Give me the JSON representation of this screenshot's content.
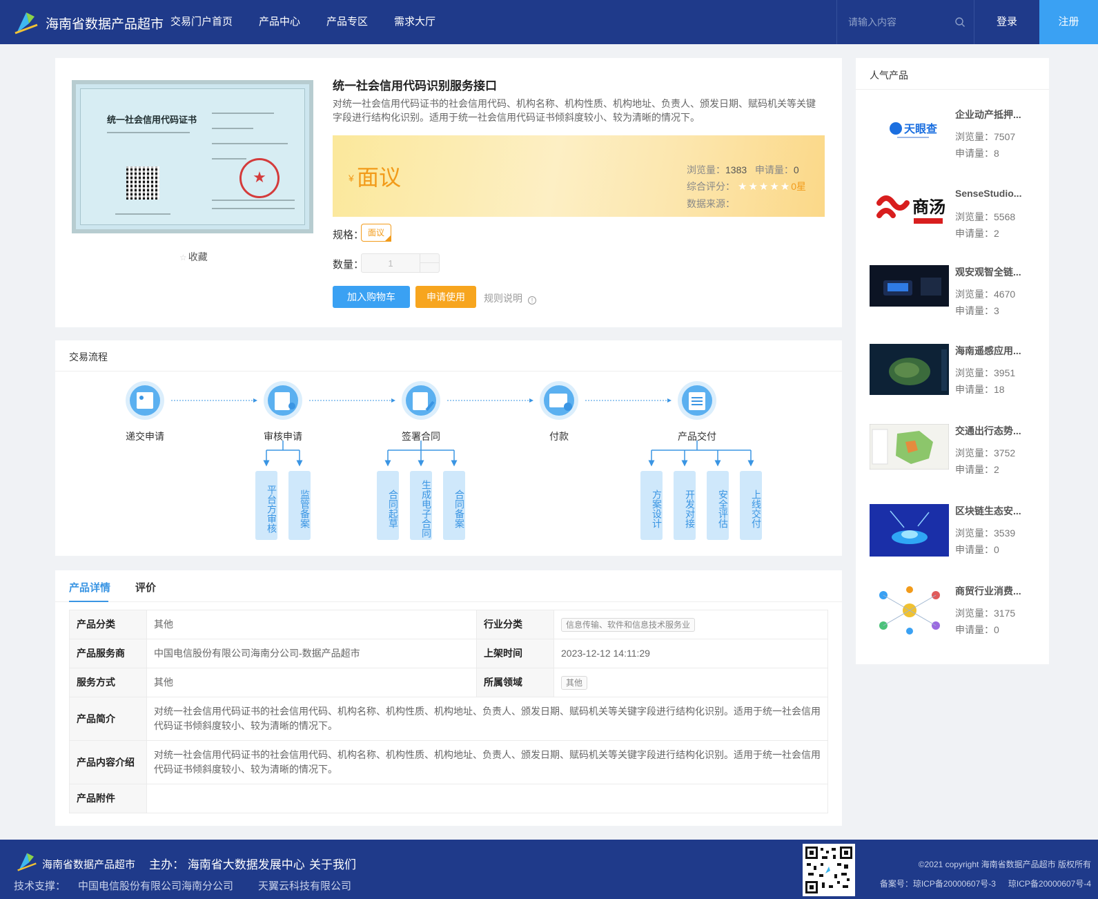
{
  "header": {
    "site_title": "海南省数据产品超市",
    "nav": [
      "交易门户首页",
      "产品中心",
      "产品专区",
      "需求大厅"
    ],
    "search_placeholder": "请输入内容",
    "login": "登录",
    "register": "注册",
    "brand_color": "#1f3a8a"
  },
  "product": {
    "title": "统一社会信用代码识别服务接口",
    "description": "对统一社会信用代码证书的社会信用代码、机构名称、机构性质、机构地址、负责人、颁发日期、赋码机关等关键字段进行结构化识别。适用于统一社会信用代码证书倾斜度较小、较为清晰的情况下。",
    "image_caption": "统一社会信用代码证书",
    "favorite": "收藏",
    "price_symbol": "¥",
    "price": "面议",
    "views_label": "浏览量：",
    "views": "1383",
    "applies_label": "申请量：",
    "applies": "0",
    "rating_label": "综合评分：",
    "rating_stars": 0,
    "rating_text": "0星",
    "source_label": "数据来源：",
    "spec_label": "规格：",
    "spec_value": "面议",
    "qty_label": "数量：",
    "qty_value": "1",
    "add_cart": "加入购物车",
    "apply": "申请使用",
    "rules": "规则说明"
  },
  "flow": {
    "title": "交易流程",
    "steps": [
      {
        "label": "递交申请",
        "subs": []
      },
      {
        "label": "审核申请",
        "subs": [
          "平台方审核",
          "监管备案"
        ]
      },
      {
        "label": "签署合同",
        "subs": [
          "合同起草",
          "生成电子合同",
          "合同备案"
        ]
      },
      {
        "label": "付款",
        "subs": []
      },
      {
        "label": "产品交付",
        "subs": [
          "方案设计",
          "开发对接",
          "安全评估",
          "上线交付"
        ]
      }
    ]
  },
  "details": {
    "tabs": [
      "产品详情",
      "评价"
    ],
    "rows": {
      "category_k": "产品分类",
      "category_v": "其他",
      "industry_k": "行业分类",
      "industry_v": "信息传输、软件和信息技术服务业",
      "provider_k": "产品服务商",
      "provider_v": "中国电信股份有限公司海南分公司-数据产品超市",
      "listed_k": "上架时间",
      "listed_v": "2023-12-12 14:11:29",
      "service_k": "服务方式",
      "service_v": "其他",
      "domain_k": "所属领域",
      "domain_v": "其他",
      "intro_k": "产品简介",
      "intro_v": "对统一社会信用代码证书的社会信用代码、机构名称、机构性质、机构地址、负责人、颁发日期、赋码机关等关键字段进行结构化识别。适用于统一社会信用代码证书倾斜度较小、较为清晰的情况下。",
      "content_k": "产品内容介绍",
      "content_v": "对统一社会信用代码证书的社会信用代码、机构名称、机构性质、机构地址、负责人、颁发日期、赋码机关等关键字段进行结构化识别。适用于统一社会信用代码证书倾斜度较小、较为清晰的情况下。",
      "attach_k": "产品附件",
      "attach_v": ""
    }
  },
  "sidebar": {
    "title": "人气产品",
    "views_label": "浏览量：",
    "applies_label": "申请量：",
    "items": [
      {
        "name": "企业动产抵押...",
        "views": "7507",
        "applies": "8",
        "thumb": "tianyancha-logo",
        "thumb_text": "天眼查"
      },
      {
        "name": "SenseStudio...",
        "views": "5568",
        "applies": "2",
        "thumb": "sensetime-logo",
        "thumb_text": "商汤"
      },
      {
        "name": "观安观智全链...",
        "views": "4670",
        "applies": "3",
        "thumb": "dashboard-screenshot"
      },
      {
        "name": "海南遥感应用...",
        "views": "3951",
        "applies": "18",
        "thumb": "satellite-map"
      },
      {
        "name": "交通出行态势...",
        "views": "3752",
        "applies": "2",
        "thumb": "traffic-map"
      },
      {
        "name": "区块链生态安...",
        "views": "3539",
        "applies": "0",
        "thumb": "blockchain-graphic"
      },
      {
        "name": "商贸行业消费...",
        "views": "3175",
        "applies": "0",
        "thumb": "network-icons"
      }
    ]
  },
  "footer": {
    "title": "海南省数据产品超市",
    "host_label": "主办：",
    "host": "海南省大数据发展中心",
    "about": "关于我们",
    "support_label": "技术支撑：",
    "support_1": "中国电信股份有限公司海南分公司",
    "support_2": "天翼云科技有限公司",
    "copyright": "©2021 copyright 海南省数据产品超市 版权所有",
    "icp_label": "备案号：",
    "icp_1": "琼ICP备20000607号-3",
    "icp_2": "琼ICP备20000607号-4"
  }
}
